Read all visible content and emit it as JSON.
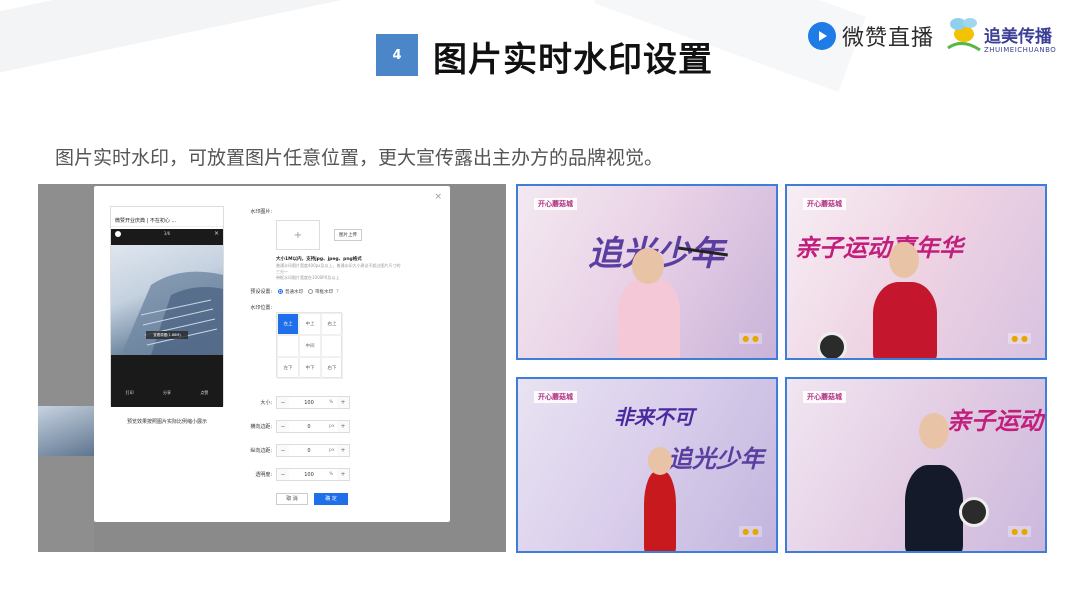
{
  "slide": {
    "number": "4",
    "title": "图片实时水印设置",
    "subtitle": "图片实时水印，可放置图片任意位置，更大宣传露出主办方的品牌视觉。"
  },
  "logos": {
    "weizan": "微赞直播",
    "zhuimei": "追美传播",
    "zhuimei_pinyin": "ZHUIMEICHUANBO"
  },
  "phone": {
    "title": "微赞开业庆典 | 不在初心 ...",
    "counter": "3/6",
    "watermark": "查看原图(1.88M)",
    "tools": [
      "打印",
      "分享",
      "点赞"
    ],
    "caption": "预览效果按照图片实际比例缩小展示"
  },
  "form": {
    "watermark_label": "水印图片:",
    "upload_plus": "+",
    "upload_button": "图片上传",
    "size_note": "大小1M以内，支持jpg、jpeg、png格式",
    "tip_line1": "普通水印图片宽度400px及以上，普通水印大小建议不超过图片尺寸的",
    "tip_line2": "三分一",
    "tip_line3": "带框水印图片宽度在1000PX及以上",
    "preset_label": "预设设置:",
    "preset_options": [
      "普通水印",
      "带框水印"
    ],
    "position_label": "水印位置:",
    "positions": [
      "左上",
      "中上",
      "右上",
      "",
      "中间",
      "",
      "左下",
      "中下",
      "右下"
    ],
    "size_label": "大小:",
    "size_value": "100",
    "size_unit": "%",
    "hmargin_label": "横向边距:",
    "hmargin_value": "0",
    "hmargin_unit": "px",
    "vmargin_label": "纵向边距:",
    "vmargin_value": "0",
    "vmargin_unit": "px",
    "opacity_label": "透明度:",
    "opacity_value": "100",
    "opacity_unit": "%",
    "cancel": "取 消",
    "confirm": "确 定"
  },
  "photos": [
    {
      "watermark": "开心蘑菇城",
      "headline": "追光少年"
    },
    {
      "watermark": "开心蘑菇城",
      "headline": "亲子运动嘉年华"
    },
    {
      "watermark": "开心蘑菇城",
      "headline": "非来不可"
    },
    {
      "watermark": "开心蘑菇城",
      "headline": "亲子运动"
    }
  ]
}
